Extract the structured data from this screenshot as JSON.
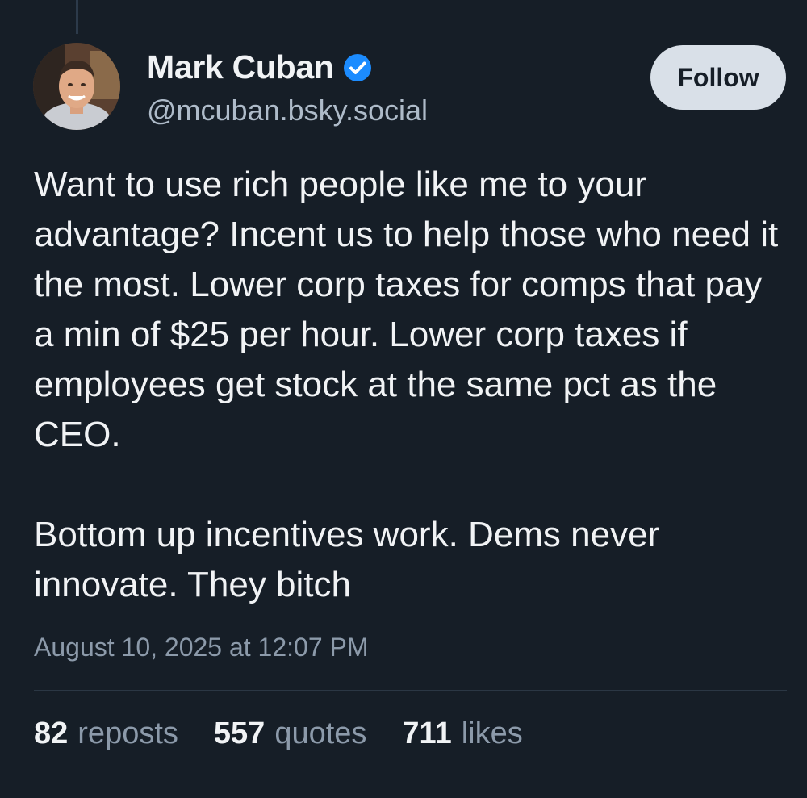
{
  "post": {
    "author": {
      "display_name": "Mark Cuban",
      "handle": "@mcuban.bsky.social",
      "verified": true,
      "avatar_icon": "user-avatar-photo"
    },
    "follow_label": "Follow",
    "body": {
      "paragraph_1": "Want to use rich people like me to your advantage? Incent us to help those who need it the most.  Lower corp taxes for comps that pay a min of $25 per hour. Lower corp taxes if employees get stock at the same pct as the CEO.",
      "paragraph_2": "Bottom up incentives work. Dems never innovate. They bitch"
    },
    "timestamp": "August 10, 2025 at 12:07 PM",
    "stats": {
      "reposts": {
        "count": "82",
        "label": "reposts"
      },
      "quotes": {
        "count": "557",
        "label": "quotes"
      },
      "likes": {
        "count": "711",
        "label": "likes"
      }
    }
  },
  "colors": {
    "background": "#161e27",
    "text_primary": "#f1f3f5",
    "text_secondary": "#8c9aaa",
    "verified_badge": "#1c8cff",
    "follow_button_bg": "#d9e0e8"
  }
}
